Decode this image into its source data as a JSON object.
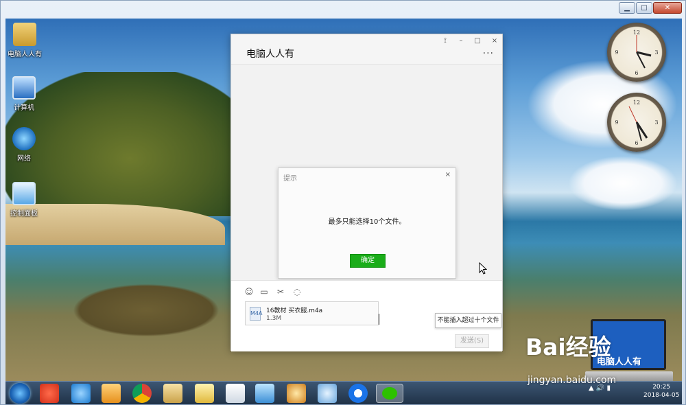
{
  "frame": {
    "title": "",
    "buttons": {
      "min": "▁",
      "max": "□",
      "close": "✕"
    }
  },
  "desktop_icons": [
    {
      "label": "电脑人人有",
      "icon": "user-folder-icon"
    },
    {
      "label": "计算机",
      "icon": "computer-icon"
    },
    {
      "label": "网络",
      "icon": "network-icon"
    },
    {
      "label": "控制面板",
      "icon": "control-panel-icon"
    }
  ],
  "chat": {
    "title": "电脑人人有",
    "window_buttons": {
      "pin": "⟟",
      "min": "–",
      "max": "□",
      "close": "×"
    },
    "more": "···",
    "toolbar": {
      "emoji": "☺",
      "folder": "▭",
      "scissors": "✂",
      "chat": "◌"
    },
    "dialog": {
      "title": "提示",
      "close": "×",
      "message": "最多只能选择10个文件。",
      "ok_label": "确定"
    },
    "file": {
      "name": "16教材 买衣服.m4a",
      "size": "1.3M",
      "icon_text": "M4A"
    },
    "tooltip": "不能插入超过十个文件",
    "send_label": "发送(S)"
  },
  "taskbar": {
    "apps": [
      "start-button",
      "jiang-app",
      "ie-icon",
      "media-icon",
      "chrome-icon",
      "explorer-icon",
      "folder-icon",
      "document-icon",
      "network-app-icon",
      "paint-icon",
      "gear-app-icon",
      "edge-icon",
      "wechat-icon"
    ],
    "time": "20:25",
    "date": "2018-04-05"
  },
  "watermark": {
    "brand": "Bai经验",
    "url": "jingyan.baidu.com",
    "laptop_text": "电脑人人有"
  },
  "colors": {
    "accent": "#1aad19",
    "taskbar": "#203247"
  }
}
